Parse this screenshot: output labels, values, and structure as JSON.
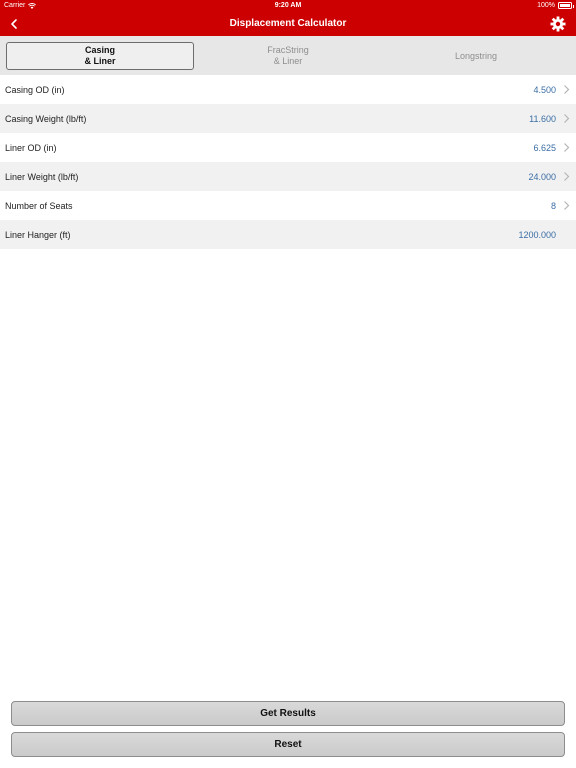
{
  "status": {
    "carrier": "Carrier",
    "time": "9:20 AM",
    "battery": "100%"
  },
  "nav": {
    "title": "Displacement Calculator"
  },
  "tabs": [
    {
      "line1": "Casing",
      "line2": "& Liner",
      "active": true
    },
    {
      "line1": "FracString",
      "line2": "& Liner",
      "active": false
    },
    {
      "line1": "Longstring",
      "line2": "",
      "active": false
    }
  ],
  "rows": [
    {
      "label": "Casing OD (in)",
      "value": "4.500",
      "chevron": true
    },
    {
      "label": "Casing Weight (lb/ft)",
      "value": "11.600",
      "chevron": true
    },
    {
      "label": "Liner OD (in)",
      "value": "6.625",
      "chevron": true
    },
    {
      "label": "Liner Weight (lb/ft)",
      "value": "24.000",
      "chevron": true
    },
    {
      "label": "Number of Seats",
      "value": "8",
      "chevron": true
    },
    {
      "label": "Liner Hanger (ft)",
      "value": "1200.000",
      "chevron": false
    }
  ],
  "buttons": {
    "get_results": "Get Results",
    "reset": "Reset"
  },
  "colors": {
    "brand": "#cc0000",
    "value_text": "#3a6ea5"
  }
}
